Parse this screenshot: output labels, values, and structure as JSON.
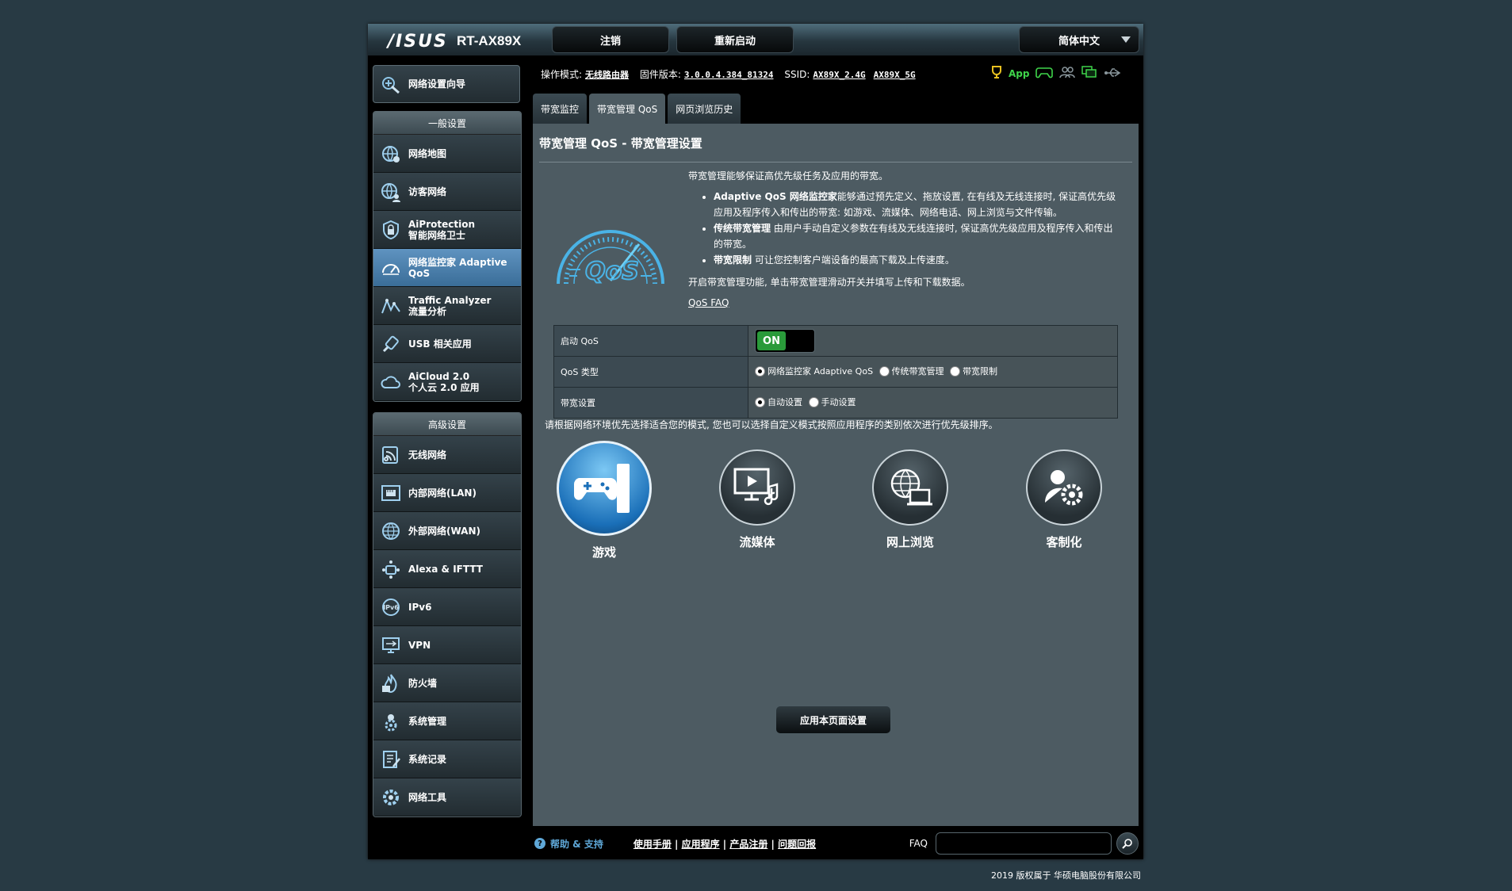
{
  "header": {
    "brand": "/ISUS",
    "model": "RT-AX89X",
    "logout_label": "注销",
    "reboot_label": "重新启动",
    "language": "简体中文"
  },
  "sidebar": {
    "quick_setup": "网络设置向导",
    "general_heading": "一般设置",
    "general_items": [
      {
        "label": "网络地图"
      },
      {
        "label": "访客网络"
      },
      {
        "label": "AiProtection\n智能网络卫士"
      },
      {
        "label": "网络监控家 Adaptive\nQoS"
      },
      {
        "label": "Traffic Analyzer\n流量分析"
      },
      {
        "label": "USB 相关应用"
      },
      {
        "label": "AiCloud 2.0\n个人云 2.0 应用"
      }
    ],
    "advanced_heading": "高级设置",
    "advanced_items": [
      {
        "label": "无线网络"
      },
      {
        "label": "内部网络(LAN)"
      },
      {
        "label": "外部网络(WAN)"
      },
      {
        "label": "Alexa & IFTTT"
      },
      {
        "label": "IPv6"
      },
      {
        "label": "VPN"
      },
      {
        "label": "防火墙"
      },
      {
        "label": "系统管理"
      },
      {
        "label": "系统记录"
      },
      {
        "label": "网络工具"
      }
    ]
  },
  "info": {
    "mode_label": "操作模式:",
    "mode_value": "无线路由器",
    "firmware_label": "固件版本:",
    "firmware_value": "3.0.0.4.384_81324",
    "ssid_label": "SSID:",
    "ssid1": "AX89X_2.4G",
    "ssid2": "AX89X_5G",
    "app_label": "App"
  },
  "tabs": [
    "带宽监控",
    "带宽管理 QoS",
    "网页浏览历史"
  ],
  "panel": {
    "title": "带宽管理 QoS - 带宽管理设置",
    "intro": "带宽管理能够保证高优先级任务及应用的带宽。",
    "b1_title": "Adaptive QoS 网络监控家",
    "b1_text": "能够通过预先定义、拖放设置, 在有线及无线连接时, 保证高优先级应用及程序传入和传出的带宽: 如游戏、流媒体、网络电话、网上浏览与文件传输。",
    "b2_title": "传统带宽管理",
    "b2_text": " 由用户手动自定义参数在有线及无线连接时, 保证高优先级应用及程序传入和传出的带宽。",
    "b3_title": "带宽限制",
    "b3_text": " 可让您控制客户端设备的最高下载及上传速度。",
    "enable_hint": "开启带宽管理功能, 单击带宽管理滑动开关并填写上传和下载数据。",
    "faq_link": "QoS FAQ",
    "qos_logo_text": "QoS"
  },
  "table": {
    "enable_label": "启动 QoS",
    "toggle_state": "ON",
    "type_label": "QoS 类型",
    "type_options": [
      "网络监控家 Adaptive QoS",
      "传统带宽管理",
      "带宽限制"
    ],
    "bw_label": "带宽设置",
    "bw_options": [
      "自动设置",
      "手动设置"
    ]
  },
  "mode_hint": "请根据网络环境优先选择适合您的模式, 您也可以选择自定义模式按照应用程序的类别依次进行优先级排序。",
  "modes": [
    "游戏",
    "流媒体",
    "网上浏览",
    "客制化"
  ],
  "apply_label": "应用本页面设置",
  "footer": {
    "help": "帮助 & 支持",
    "links": [
      "使用手册",
      "应用程序",
      "产品注册",
      "问题回报"
    ],
    "faq": "FAQ"
  },
  "copyright": "2019 版权属于 华硕电脑股份有限公司"
}
